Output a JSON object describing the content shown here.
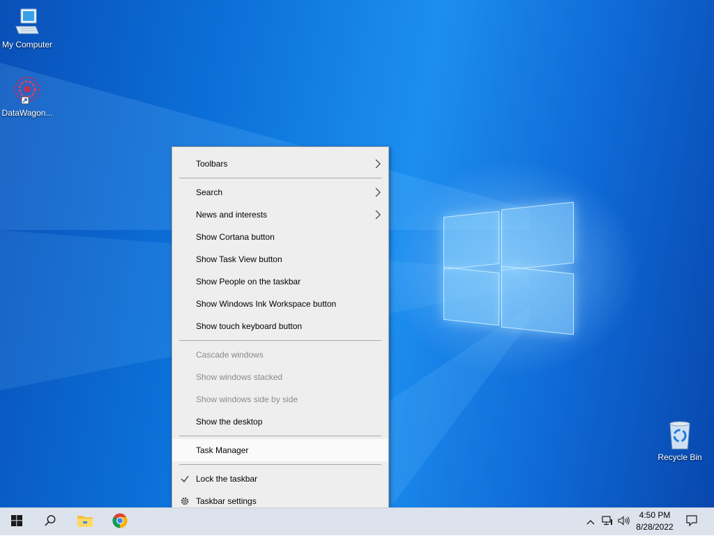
{
  "desktop": {
    "icons": [
      {
        "label": "My Computer",
        "icon": "computer-icon"
      },
      {
        "label": "DataWagon...",
        "icon": "datawagon-app-icon"
      },
      {
        "label": "Recycle Bin",
        "icon": "recycle-bin-icon"
      }
    ]
  },
  "context_menu": {
    "items": [
      {
        "label": "Toolbars",
        "submenu": true
      },
      {
        "label": "Search",
        "submenu": true
      },
      {
        "label": "News and interests",
        "submenu": true
      },
      {
        "label": "Show Cortana button"
      },
      {
        "label": "Show Task View button"
      },
      {
        "label": "Show People on the taskbar"
      },
      {
        "label": "Show Windows Ink Workspace button"
      },
      {
        "label": "Show touch keyboard button"
      },
      {
        "label": "Cascade windows",
        "disabled": true
      },
      {
        "label": "Show windows stacked",
        "disabled": true
      },
      {
        "label": "Show windows side by side",
        "disabled": true
      },
      {
        "label": "Show the desktop"
      },
      {
        "label": "Task Manager",
        "highlighted": true
      },
      {
        "label": "Lock the taskbar",
        "checked": true
      },
      {
        "label": "Taskbar settings",
        "icon": "gear-icon"
      }
    ]
  },
  "taskbar": {
    "pinned": [
      "windows-start-icon",
      "search-icon",
      "file-explorer-icon",
      "chrome-icon"
    ],
    "tray_icons": [
      "chevron-up-icon",
      "network-icon",
      "volume-icon",
      "notification-icon"
    ],
    "clock": {
      "time": "4:50 PM",
      "date": "8/28/2022"
    }
  },
  "colors": {
    "desktop_accent": "#0b6fd8",
    "menu_bg": "#eeeeee",
    "taskbar_bg": "#dde3ec"
  }
}
